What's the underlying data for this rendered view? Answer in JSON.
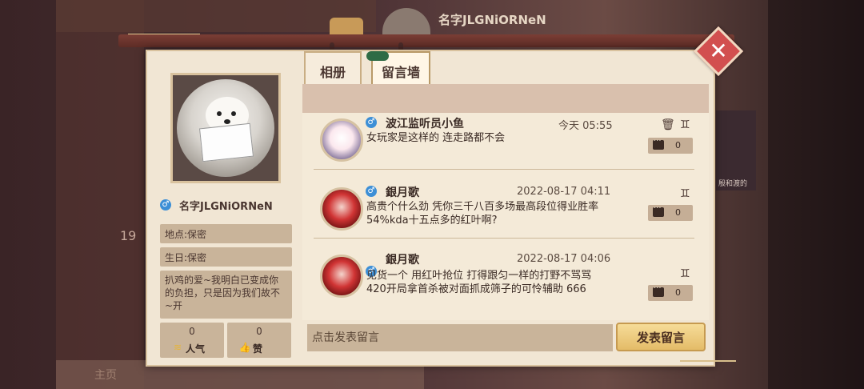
{
  "background": {
    "top_name": "名字JLGNiORNeN",
    "year_fragment": "19",
    "bottom_tab_label": "主页",
    "right_caption": "殷和渡的"
  },
  "tabs": [
    {
      "label": "相册",
      "active": false
    },
    {
      "label": "留言墙",
      "active": true
    }
  ],
  "profile": {
    "gender": "male",
    "name": "名字JLGNiORNeN",
    "location": "地点:保密",
    "birthday": "生日:保密",
    "signature": "扒鸡的爱~我明白已变成你的负担，只是因为我们故不~开",
    "popularity_count": "0",
    "popularity_label": "人气",
    "likes_count": "0",
    "likes_label": "赞"
  },
  "messages": [
    {
      "author": "波江监听员小鱼",
      "time": "今天 05:55",
      "text": "女玩家是这样的 连走路都不会",
      "reply_count": "0",
      "deletable": true
    },
    {
      "author": "銀月歌",
      "time": "2022-08-17 04:11",
      "text": "高贵个什么劲 凭你三千八百多场最高段位得业胜率54%kda十五点多的红叶啊?",
      "reply_count": "0",
      "deletable": false
    },
    {
      "author": "銀月歌",
      "time": "2022-08-17 04:06",
      "text": "见货一个 用红叶抢位 打得跟匀一样的打野不骂骂420开局拿首杀被对面抓成筛子的可怜辅助 666",
      "reply_count": "0",
      "deletable": false
    }
  ],
  "input": {
    "placeholder": "点击发表留言",
    "value": ""
  },
  "post_button": "发表留言",
  "colors": {
    "panel": "#f1e6d4",
    "close_button": "#d24f4f",
    "gender_male": "#3d8fd6",
    "post_button": "#e4bc68"
  },
  "icons": {
    "close": "close-icon",
    "delete": "trash-icon",
    "report": "report-icon",
    "reply": "comment-icon"
  }
}
